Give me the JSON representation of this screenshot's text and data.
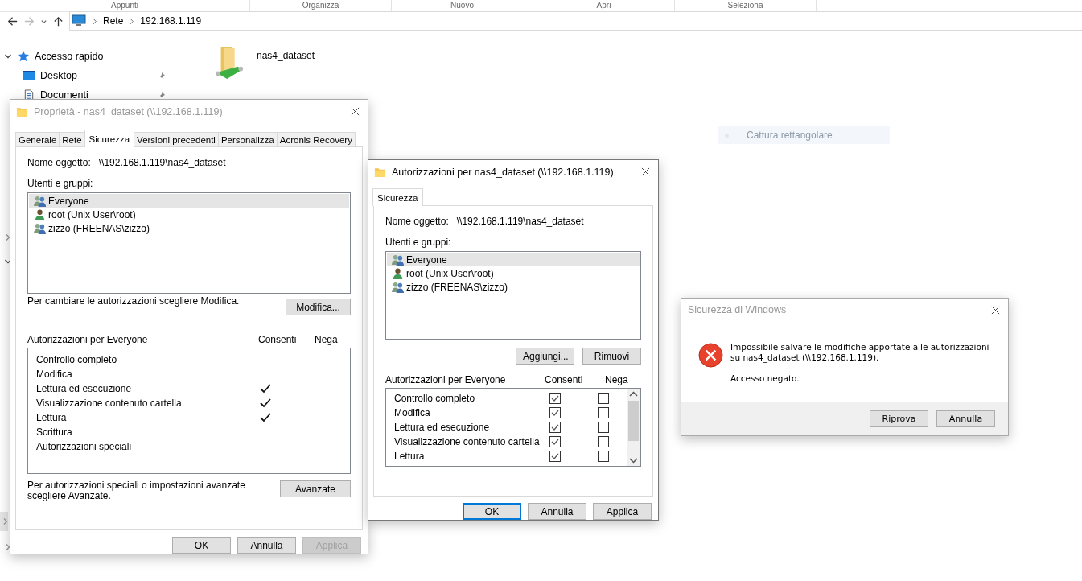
{
  "ribbon_groups": [
    "Appunti",
    "Organizza",
    "Nuovo",
    "Apri",
    "Seleziona"
  ],
  "address_bar": {
    "path": [
      "Rete",
      "192.168.1.119"
    ]
  },
  "navigation_pane": {
    "items": [
      {
        "label": "Accesso rapido",
        "expanded": true,
        "selected": false,
        "children": [
          {
            "label": "Desktop",
            "pinned": true
          },
          {
            "label": "Documenti",
            "pinned": true
          }
        ]
      },
      {
        "expanded": false,
        "selected": false
      },
      {
        "expanded": true,
        "selected": false
      },
      {
        "expanded": false,
        "selected": true
      },
      {
        "expanded": false,
        "selected": false
      }
    ]
  },
  "content": {
    "items": [
      {
        "name": "nas4_dataset"
      }
    ]
  },
  "snip_hint": "Cattura rettangolare",
  "properties_dialog": {
    "title": "Proprietà - nas4_dataset (\\\\192.168.1.119)",
    "tabs": [
      {
        "label": "Generale",
        "selected": false
      },
      {
        "label": "Rete",
        "selected": false
      },
      {
        "label": "Sicurezza",
        "selected": true
      },
      {
        "label": "Versioni precedenti",
        "selected": false
      },
      {
        "label": "Personalizza",
        "selected": false
      },
      {
        "label": "Acronis Recovery",
        "selected": false
      }
    ],
    "object_label": "Nome oggetto:",
    "object_name": "\\\\192.168.1.119\\nas4_dataset",
    "users_label": "Utenti e gruppi:",
    "users": [
      {
        "name": "Everyone",
        "kind": "group",
        "selected": true
      },
      {
        "name": "root (Unix User\\root)",
        "kind": "user",
        "selected": false
      },
      {
        "name": "zizzo (FREENAS\\zizzo)",
        "kind": "group",
        "selected": false
      }
    ],
    "change_hint": "Per cambiare le autorizzazioni scegliere Modifica.",
    "edit_button": "Modifica...",
    "permissions_label": "Autorizzazioni per Everyone",
    "allow_label": "Consenti",
    "deny_label": "Nega",
    "permissions": [
      {
        "name": "Controllo completo",
        "allow": false
      },
      {
        "name": "Modifica",
        "allow": false
      },
      {
        "name": "Lettura ed esecuzione",
        "allow": true
      },
      {
        "name": "Visualizzazione contenuto cartella",
        "allow": true
      },
      {
        "name": "Lettura",
        "allow": true
      },
      {
        "name": "Scrittura",
        "allow": false
      },
      {
        "name": "Autorizzazioni speciali",
        "allow": false
      }
    ],
    "advanced_hint": "Per autorizzazioni speciali o impostazioni avanzate scegliere Avanzate.",
    "advanced_button": "Avanzate",
    "buttons": [
      {
        "label": "OK",
        "disabled": false,
        "focused": false
      },
      {
        "label": "Annulla",
        "disabled": false,
        "focused": false
      },
      {
        "label": "Applica",
        "disabled": true,
        "focused": false
      }
    ]
  },
  "permissions_dialog": {
    "title": "Autorizzazioni per nas4_dataset (\\\\192.168.1.119)",
    "tabs": [
      {
        "label": "Sicurezza",
        "selected": true
      }
    ],
    "object_label": "Nome oggetto:",
    "object_name": "\\\\192.168.1.119\\nas4_dataset",
    "users_label": "Utenti e gruppi:",
    "users": [
      {
        "name": "Everyone",
        "kind": "group",
        "selected": true
      },
      {
        "name": "root (Unix User\\root)",
        "kind": "user",
        "selected": false
      },
      {
        "name": "zizzo (FREENAS\\zizzo)",
        "kind": "group",
        "selected": false
      }
    ],
    "user_buttons": [
      "Aggiungi...",
      "Rimuovi"
    ],
    "permissions_label": "Autorizzazioni per Everyone",
    "allow_label": "Consenti",
    "deny_label": "Nega",
    "permissions": [
      {
        "name": "Controllo completo",
        "allow": true,
        "deny": false
      },
      {
        "name": "Modifica",
        "allow": true,
        "deny": false
      },
      {
        "name": "Lettura ed esecuzione",
        "allow": true,
        "deny": false
      },
      {
        "name": "Visualizzazione contenuto cartella",
        "allow": true,
        "deny": false
      },
      {
        "name": "Lettura",
        "allow": true,
        "deny": false
      }
    ],
    "buttons": [
      {
        "label": "OK",
        "disabled": false,
        "focused": true
      },
      {
        "label": "Annulla",
        "disabled": false,
        "focused": false
      },
      {
        "label": "Applica",
        "disabled": false,
        "focused": false
      }
    ]
  },
  "error_dialog": {
    "title": "Sicurezza di Windows",
    "message": "Impossibile salvare le modifiche apportate alle autorizzazioni su nas4_dataset (\\\\192.168.1.119).",
    "detail": "Accesso negato.",
    "buttons": [
      {
        "label": "Riprova",
        "disabled": false,
        "focused": false
      },
      {
        "label": "Annulla",
        "disabled": false,
        "focused": false
      }
    ]
  }
}
